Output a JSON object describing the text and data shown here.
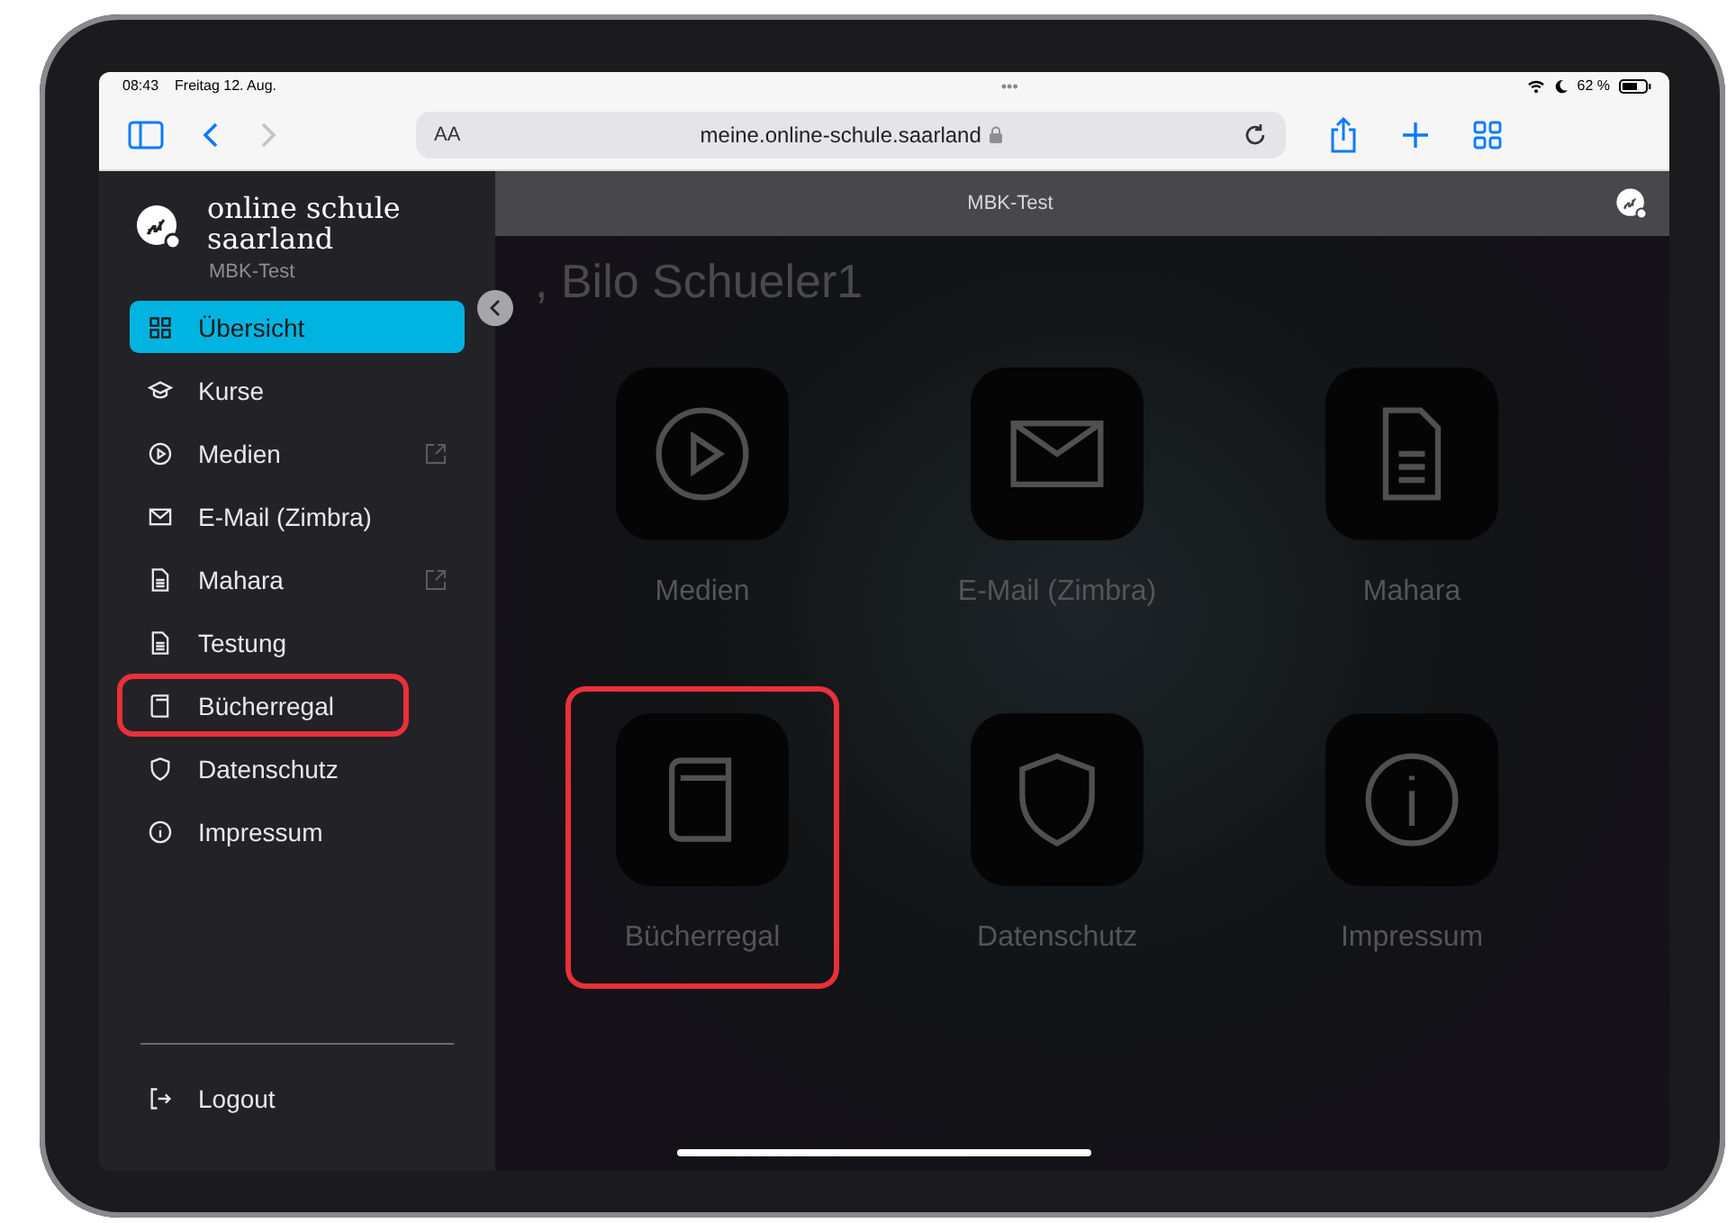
{
  "status_bar": {
    "time": "08:43",
    "date": "Freitag 12. Aug.",
    "dots": "•••",
    "battery": "62 %"
  },
  "browser": {
    "text_size": "AA",
    "url": "meine.online-schule.saarland"
  },
  "sidebar": {
    "brand": "online schule saarland",
    "subtitle": "MBK-Test",
    "items": [
      {
        "label": "Übersicht",
        "kind": "grid",
        "selected": true,
        "external": false,
        "highlighted": false
      },
      {
        "label": "Kurse",
        "kind": "cap",
        "selected": false,
        "external": false,
        "highlighted": false
      },
      {
        "label": "Medien",
        "kind": "play",
        "selected": false,
        "external": true,
        "highlighted": false
      },
      {
        "label": "E-Mail (Zimbra)",
        "kind": "mail",
        "selected": false,
        "external": false,
        "highlighted": false
      },
      {
        "label": "Mahara",
        "kind": "doc",
        "selected": false,
        "external": true,
        "highlighted": false
      },
      {
        "label": "Testung",
        "kind": "doc",
        "selected": false,
        "external": false,
        "highlighted": false
      },
      {
        "label": "Bücherregal",
        "kind": "book",
        "selected": false,
        "external": false,
        "highlighted": true
      },
      {
        "label": "Datenschutz",
        "kind": "shield",
        "selected": false,
        "external": false,
        "highlighted": false
      },
      {
        "label": "Impressum",
        "kind": "info",
        "selected": false,
        "external": false,
        "highlighted": false
      }
    ],
    "logout": "Logout"
  },
  "header": {
    "title": "MBK-Test"
  },
  "greeting": ", Bilo Schueler1",
  "tiles": [
    {
      "label": "Medien",
      "kind": "play",
      "highlighted": false
    },
    {
      "label": "E-Mail (Zimbra)",
      "kind": "mail",
      "highlighted": false
    },
    {
      "label": "Mahara",
      "kind": "doc",
      "highlighted": false
    },
    {
      "label": "Bücherregal",
      "kind": "book",
      "highlighted": true
    },
    {
      "label": "Datenschutz",
      "kind": "shield",
      "highlighted": false
    },
    {
      "label": "Impressum",
      "kind": "info",
      "highlighted": false
    }
  ]
}
